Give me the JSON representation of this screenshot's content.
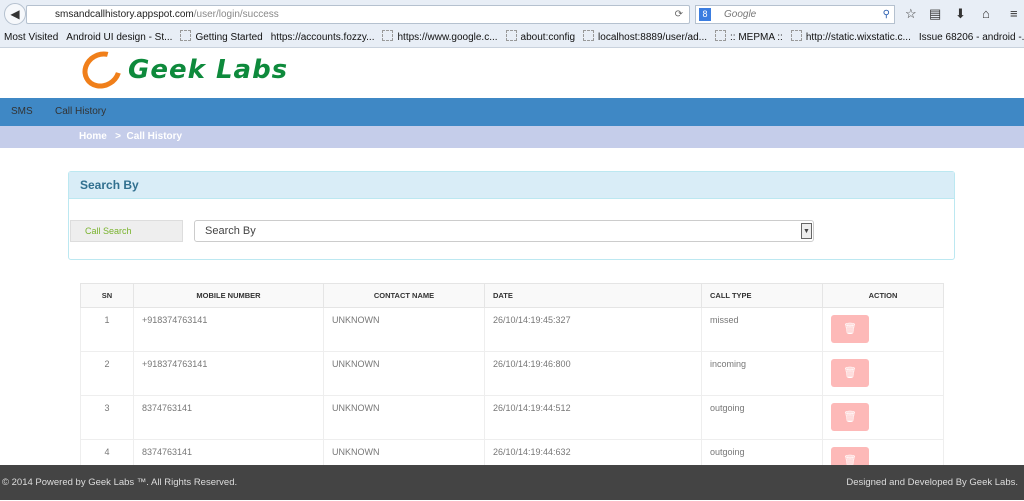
{
  "browser": {
    "url_host": "smsandcallhistory.appspot.com",
    "url_path": "/user/login/success",
    "search_placeholder": "Google",
    "bookmarks": [
      "Most Visited",
      "Android UI design - St...",
      "Getting Started",
      "https://accounts.fozzy...",
      "https://www.google.c...",
      "about:config",
      "localhost:8889/user/ad...",
      ":: MEPMA ::",
      "http://static.wixstatic.c...",
      "Issue 68206 - android -..."
    ]
  },
  "brand": {
    "name": "Geek Labs",
    "orange": "#f07f1a",
    "green": "#0e8a3c"
  },
  "nav": {
    "items": [
      "SMS",
      "Call History"
    ]
  },
  "breadcrumb": {
    "home": "Home",
    "sep": ">",
    "current": "Call History"
  },
  "search": {
    "title": "Search By",
    "label": "Call Search",
    "select_value": "Search By"
  },
  "table": {
    "headers": [
      "SN",
      "MOBILE NUMBER",
      "CONTACT NAME",
      "DATE",
      "CALL TYPE",
      "ACTION"
    ],
    "rows": [
      [
        "1",
        "+918374763141",
        "UNKNOWN",
        "26/10/14:19:45:327",
        "missed"
      ],
      [
        "2",
        "+918374763141",
        "UNKNOWN",
        "26/10/14:19:46:800",
        "incoming"
      ],
      [
        "3",
        "8374763141",
        "UNKNOWN",
        "26/10/14:19:44:512",
        "outgoing"
      ],
      [
        "4",
        "8374763141",
        "UNKNOWN",
        "26/10/14:19:44:632",
        "outgoing"
      ]
    ]
  },
  "footer": {
    "left": "© 2014 Powered by Geek Labs ™. All Rights Reserved.",
    "right": "Designed and Developed By Geek Labs."
  }
}
